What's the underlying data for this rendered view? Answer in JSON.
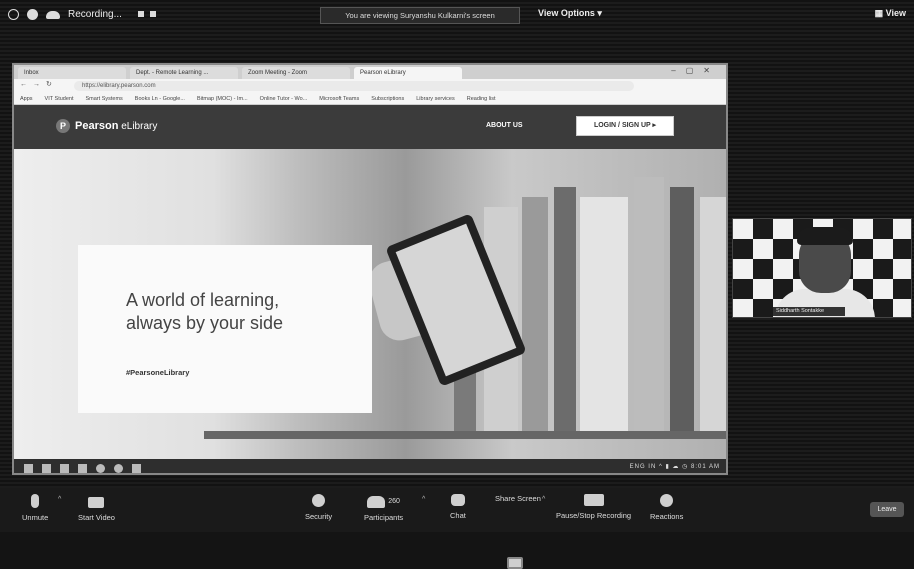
{
  "topbar": {
    "recording_label": "Recording...",
    "banner_text": "You are viewing Suryanshu Kulkarni's screen",
    "view_options": "View Options ▾",
    "view_right": "▦ View"
  },
  "browser": {
    "tabs": [
      "Inbox",
      "Dept. - Remote Learning ...",
      "Zoom Meeting - Zoom",
      "Pearson eLibrary"
    ],
    "active_tab_index": 3,
    "url": "https://elibrary.pearson.com",
    "bookmarks": [
      "Apps",
      "VIT Student",
      "Smart Systems",
      "Books Ln - Google...",
      "Bitmap (MOC) - Im...",
      "Online Tutor - Wo...",
      "Microsoft Teams",
      "Subscriptions",
      "Library services",
      "Reading list"
    ]
  },
  "site": {
    "logo_mark": "P",
    "logo_brand": "Pearson",
    "logo_product": "eLibrary",
    "about_label": "ABOUT US",
    "login_label": "LOGIN / SIGN UP ▸",
    "hero_line1": "A world of learning,",
    "hero_line2": "always by your side",
    "hashtag": "#PearsoneLibrary"
  },
  "taskbar": {
    "tray_text": "ENG  IN  ^  ▮  ☁  ◷  8:01 AM"
  },
  "participant": {
    "name": "Siddharth Sontakke"
  },
  "toolbar": {
    "unmute": "Unmute",
    "start_video": "Start Video",
    "security": "Security",
    "participants": "Participants",
    "participants_count": "260",
    "chat": "Chat",
    "share_screen": "Share Screen",
    "recording": "Pause/Stop Recording",
    "reactions": "Reactions",
    "leave": "Leave"
  }
}
